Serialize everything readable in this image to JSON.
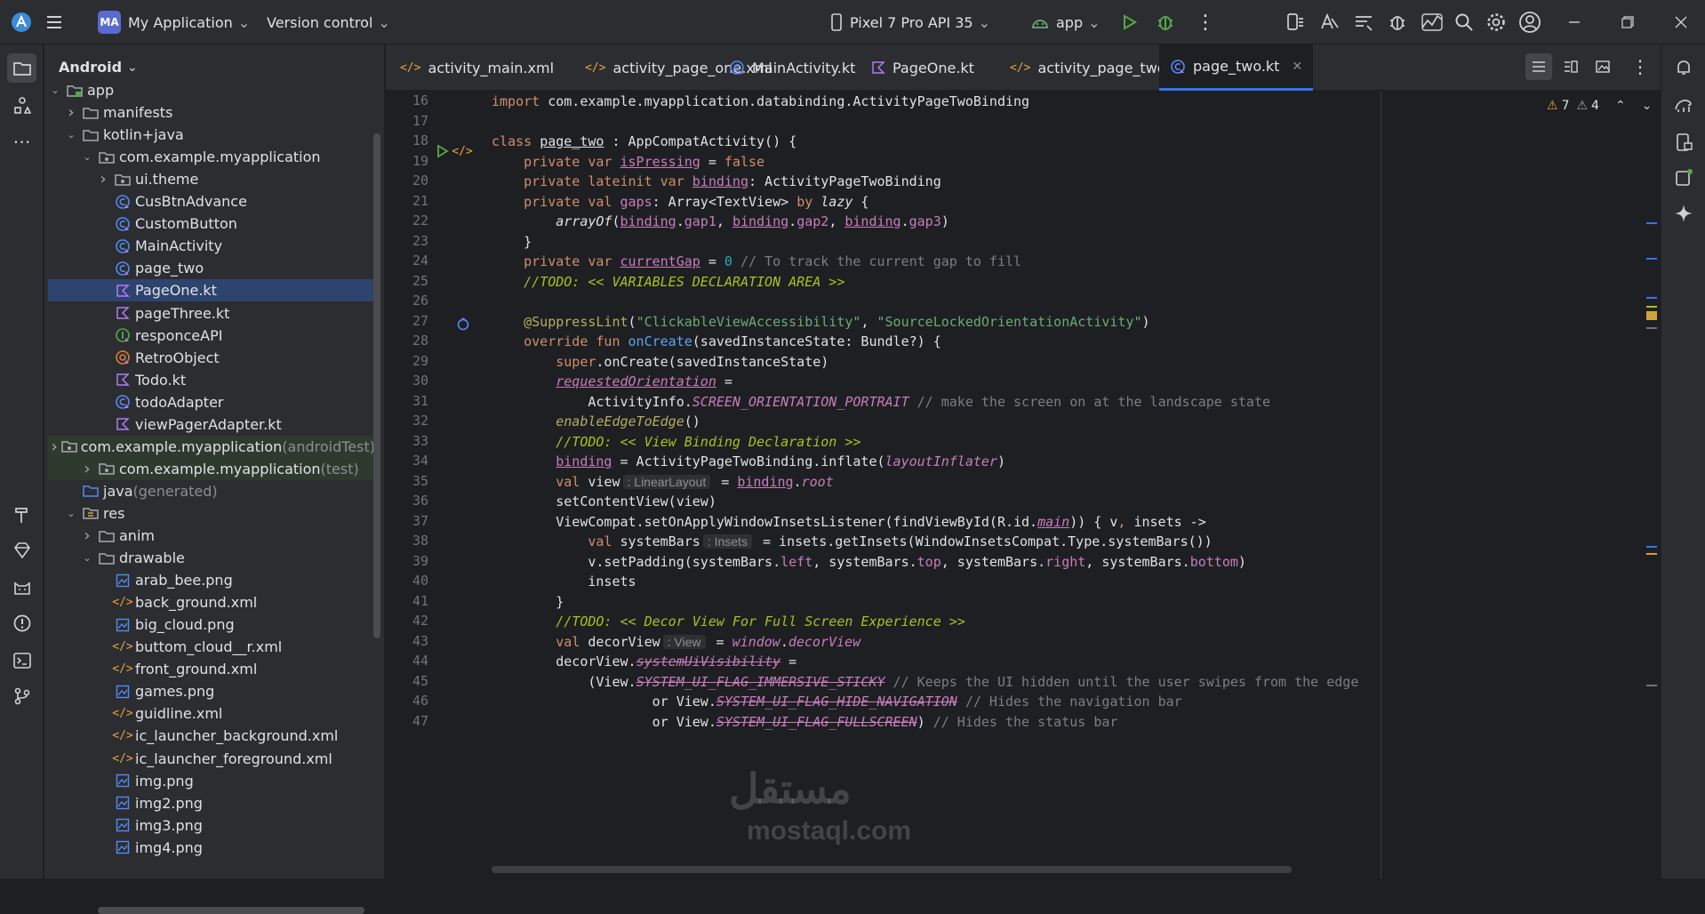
{
  "titlebar": {
    "project_badge": "MA",
    "project_name": "My Application",
    "vcs": "Version control",
    "device": "Pixel 7 Pro API 35",
    "run_config": "app"
  },
  "project_panel": {
    "view": "Android",
    "tree": [
      {
        "label": "app",
        "depth": 0,
        "arrow": "open",
        "icon": "module-folder-icon"
      },
      {
        "label": "manifests",
        "depth": 1,
        "arrow": "closed",
        "icon": "folder-icon"
      },
      {
        "label": "kotlin+java",
        "depth": 1,
        "arrow": "open",
        "icon": "folder-icon"
      },
      {
        "label": "com.example.myapplication",
        "depth": 2,
        "arrow": "open",
        "icon": "package-icon"
      },
      {
        "label": "ui.theme",
        "depth": 3,
        "arrow": "closed",
        "icon": "package-icon"
      },
      {
        "label": "CusBtnAdvance",
        "depth": 3,
        "icon": "class-icon"
      },
      {
        "label": "CustomButton",
        "depth": 3,
        "icon": "class-icon"
      },
      {
        "label": "MainActivity",
        "depth": 3,
        "icon": "class-icon"
      },
      {
        "label": "page_two",
        "depth": 3,
        "icon": "class-icon"
      },
      {
        "label": "PageOne.kt",
        "depth": 3,
        "icon": "kotlin-file-icon",
        "selected": true
      },
      {
        "label": "pageThree.kt",
        "depth": 3,
        "icon": "kotlin-file-icon"
      },
      {
        "label": "responceAPI",
        "depth": 3,
        "icon": "interface-icon"
      },
      {
        "label": "RetroObject",
        "depth": 3,
        "icon": "object-icon"
      },
      {
        "label": "Todo.kt",
        "depth": 3,
        "icon": "kotlin-file-icon"
      },
      {
        "label": "todoAdapter",
        "depth": 3,
        "icon": "class-icon"
      },
      {
        "label": "viewPagerAdapter.kt",
        "depth": 3,
        "icon": "kotlin-file-icon"
      },
      {
        "label": "com.example.myapplication",
        "suffix": " (androidTest)",
        "depth": 2,
        "arrow": "closed",
        "icon": "package-icon",
        "test": true
      },
      {
        "label": "com.example.myapplication",
        "suffix": " (test)",
        "depth": 2,
        "arrow": "closed",
        "icon": "package-icon",
        "test": true
      },
      {
        "label": "java",
        "suffix": " (generated)",
        "depth": 1,
        "icon": "generated-folder-icon"
      },
      {
        "label": "res",
        "depth": 1,
        "arrow": "open",
        "icon": "res-folder-icon"
      },
      {
        "label": "anim",
        "depth": 2,
        "arrow": "closed",
        "icon": "folder-icon"
      },
      {
        "label": "drawable",
        "depth": 2,
        "arrow": "open",
        "icon": "folder-icon"
      },
      {
        "label": "arab_bee.png",
        "depth": 3,
        "icon": "image-file-icon"
      },
      {
        "label": "back_ground.xml",
        "depth": 3,
        "icon": "xml-file-icon"
      },
      {
        "label": "big_cloud.png",
        "depth": 3,
        "icon": "image-file-icon"
      },
      {
        "label": "buttom_cloud__r.xml",
        "depth": 3,
        "icon": "xml-file-icon"
      },
      {
        "label": "front_ground.xml",
        "depth": 3,
        "icon": "xml-file-icon"
      },
      {
        "label": "games.png",
        "depth": 3,
        "icon": "image-file-icon"
      },
      {
        "label": "guidline.xml",
        "depth": 3,
        "icon": "xml-file-icon"
      },
      {
        "label": "ic_launcher_background.xml",
        "depth": 3,
        "icon": "xml-file-icon"
      },
      {
        "label": "ic_launcher_foreground.xml",
        "depth": 3,
        "icon": "xml-file-icon"
      },
      {
        "label": "img.png",
        "depth": 3,
        "icon": "image-file-icon"
      },
      {
        "label": "img2.png",
        "depth": 3,
        "icon": "image-file-icon"
      },
      {
        "label": "img3.png",
        "depth": 3,
        "icon": "image-file-icon"
      },
      {
        "label": "img4.png",
        "depth": 3,
        "icon": "image-file-icon"
      }
    ]
  },
  "tabs": [
    {
      "label": "activity_main.xml",
      "icon": "xml-file-icon"
    },
    {
      "label": "activity_page_one.xml",
      "icon": "xml-file-icon"
    },
    {
      "label": "MainActivity.kt",
      "icon": "class-icon"
    },
    {
      "label": "PageOne.kt",
      "icon": "kotlin-file-icon"
    },
    {
      "label": "activity_page_two.xml",
      "icon": "xml-file-icon"
    },
    {
      "label": "page_two.kt",
      "icon": "class-icon",
      "active": true
    }
  ],
  "inspections": {
    "warnings": "7",
    "weak_warnings": "4"
  },
  "editor": {
    "line_numbers": [
      "16",
      "17",
      "18",
      "19",
      "20",
      "21",
      "22",
      "23",
      "24",
      "25",
      "26",
      "27",
      "28",
      "29",
      "30",
      "31",
      "32",
      "33",
      "34",
      "35",
      "36",
      "37",
      "38",
      "39",
      "40",
      "41",
      "42",
      "43",
      "44",
      "45",
      "46",
      "47"
    ],
    "lines": [
      [
        [
          "kw",
          "import "
        ],
        [
          "",
          "com.example.myapplication.databinding.ActivityPageTwoBinding"
        ]
      ],
      [],
      [
        [
          "kw",
          "class "
        ],
        [
          "u",
          "page_two"
        ],
        [
          "",
          " : AppCompatActivity() {"
        ]
      ],
      [
        [
          "",
          "    "
        ],
        [
          "kw",
          "private var "
        ],
        [
          "prop u",
          "isPressing"
        ],
        [
          "",
          " = "
        ],
        [
          "kw",
          "false"
        ]
      ],
      [
        [
          "",
          "    "
        ],
        [
          "kw",
          "private lateinit var "
        ],
        [
          "prop u",
          "binding"
        ],
        [
          "",
          ": ActivityPageTwoBinding"
        ]
      ],
      [
        [
          "",
          "    "
        ],
        [
          "kw",
          "private val "
        ],
        [
          "prop",
          "gaps"
        ],
        [
          "",
          ": Array<TextView> "
        ],
        [
          "kw",
          "by "
        ],
        [
          "ital",
          "lazy"
        ],
        [
          "",
          " {"
        ]
      ],
      [
        [
          "",
          "        "
        ],
        [
          "ital",
          "arrayOf"
        ],
        [
          "",
          "("
        ],
        [
          "prop u",
          "binding"
        ],
        [
          "",
          "."
        ],
        [
          "prop",
          "gap1"
        ],
        [
          "",
          ", "
        ],
        [
          "prop u",
          "binding"
        ],
        [
          "",
          "."
        ],
        [
          "prop",
          "gap2"
        ],
        [
          "",
          ", "
        ],
        [
          "prop u",
          "binding"
        ],
        [
          "",
          "."
        ],
        [
          "prop",
          "gap3"
        ],
        [
          "",
          ")"
        ]
      ],
      [
        [
          "",
          "    }"
        ]
      ],
      [
        [
          "",
          "    "
        ],
        [
          "kw",
          "private var "
        ],
        [
          "prop u",
          "currentGap"
        ],
        [
          "",
          " = "
        ],
        [
          "num",
          "0"
        ],
        [
          "cm",
          " // To track the current gap to fill"
        ]
      ],
      [
        [
          "",
          "    "
        ],
        [
          "todo",
          "//TODO: << VARIABLES DECLARATION AREA >>"
        ]
      ],
      [],
      [
        [
          "",
          "    "
        ],
        [
          "ann",
          "@SuppressLint"
        ],
        [
          "",
          "("
        ],
        [
          "str",
          "\"ClickableViewAccessibility\""
        ],
        [
          "",
          ", "
        ],
        [
          "str",
          "\"SourceLockedOrientationActivity\""
        ],
        [
          "",
          ")"
        ]
      ],
      [
        [
          "",
          "    "
        ],
        [
          "kw",
          "override fun "
        ],
        [
          "fn",
          "onCreate"
        ],
        [
          "",
          "(savedInstanceState: Bundle?) {"
        ]
      ],
      [
        [
          "",
          "        "
        ],
        [
          "kw",
          "super"
        ],
        [
          "",
          ".onCreate(savedInstanceState)"
        ]
      ],
      [
        [
          "",
          "        "
        ],
        [
          "prop ital u",
          "requestedOrientation"
        ],
        [
          "",
          " ="
        ]
      ],
      [
        [
          "",
          "            ActivityInfo."
        ],
        [
          "prop ital",
          "SCREEN_ORIENTATION_PORTRAIT"
        ],
        [
          "cm",
          " // make the screen on at the landscape state"
        ]
      ],
      [
        [
          "",
          "        "
        ],
        [
          "ann ital",
          "enableEdgeToEdge"
        ],
        [
          "",
          "()"
        ]
      ],
      [
        [
          "",
          "        "
        ],
        [
          "todo",
          "//TODO: << View Binding Declaration >>"
        ]
      ],
      [
        [
          "",
          "        "
        ],
        [
          "prop u",
          "binding"
        ],
        [
          "",
          " = ActivityPageTwoBinding.inflate("
        ],
        [
          "prop ital",
          "layoutInflater"
        ],
        [
          "",
          ")"
        ]
      ],
      [
        [
          "",
          "        "
        ],
        [
          "kw",
          "val "
        ],
        [
          "",
          "view"
        ],
        [
          "hint",
          ": LinearLayout"
        ],
        [
          "",
          " = "
        ],
        [
          "prop u",
          "binding"
        ],
        [
          "",
          "."
        ],
        [
          "prop ital",
          "root"
        ]
      ],
      [
        [
          "",
          "        setContentView(view)"
        ]
      ],
      [
        [
          "",
          "        ViewCompat.setOnApplyWindowInsetsListener(findViewById(R.id."
        ],
        [
          "prop ital u",
          "main"
        ],
        [
          "",
          ")) { v"
        ],
        [
          "kw",
          ","
        ],
        [
          "",
          " insets ->"
        ]
      ],
      [
        [
          "",
          "            "
        ],
        [
          "kw",
          "val "
        ],
        [
          "",
          "systemBars"
        ],
        [
          "hint",
          ": Insets"
        ],
        [
          "",
          " = insets.getInsets(WindowInsetsCompat.Type.systemBars())"
        ]
      ],
      [
        [
          "",
          "            v.setPadding(systemBars."
        ],
        [
          "prop",
          "left"
        ],
        [
          "",
          ", systemBars."
        ],
        [
          "prop",
          "top"
        ],
        [
          "",
          ", systemBars."
        ],
        [
          "prop",
          "right"
        ],
        [
          "",
          ", systemBars."
        ],
        [
          "prop",
          "bottom"
        ],
        [
          "",
          ")"
        ]
      ],
      [
        [
          "",
          "            insets"
        ]
      ],
      [
        [
          "",
          "        }"
        ]
      ],
      [
        [
          "",
          "        "
        ],
        [
          "todo",
          "//TODO: << Decor View For Full Screen Experience >>"
        ]
      ],
      [
        [
          "",
          "        "
        ],
        [
          "kw",
          "val "
        ],
        [
          "",
          "decorView"
        ],
        [
          "hint",
          ": View"
        ],
        [
          "",
          " = "
        ],
        [
          "prop ital",
          "window"
        ],
        [
          "",
          "."
        ],
        [
          "prop ital",
          "decorView"
        ]
      ],
      [
        [
          "",
          "        decorView."
        ],
        [
          "prop ital u strike",
          "systemUiVisibility"
        ],
        [
          "",
          " ="
        ]
      ],
      [
        [
          "",
          "            (View."
        ],
        [
          "prop ital strike",
          "SYSTEM_UI_FLAG_IMMERSIVE_STICKY"
        ],
        [
          "cm",
          " // Keeps the UI hidden until the user swipes from the edge"
        ]
      ],
      [
        [
          "",
          "                    or View."
        ],
        [
          "prop ital strike",
          "SYSTEM_UI_FLAG_HIDE_NAVIGATION"
        ],
        [
          "cm",
          " // Hides the navigation bar"
        ]
      ],
      [
        [
          "",
          "                    or View."
        ],
        [
          "prop ital strike",
          "SYSTEM_UI_FLAG_FULLSCREEN"
        ],
        [
          "",
          ")"
        ],
        [
          "cm",
          " // Hides the status bar"
        ]
      ]
    ]
  },
  "watermark": {
    "arabic": "مستقل",
    "latin": "mostaql.com"
  },
  "colors": {
    "accent": "#3574f0",
    "keyword": "#cf8e6d",
    "property": "#c77dbb",
    "string": "#6aab73",
    "todo": "#a8c023"
  }
}
